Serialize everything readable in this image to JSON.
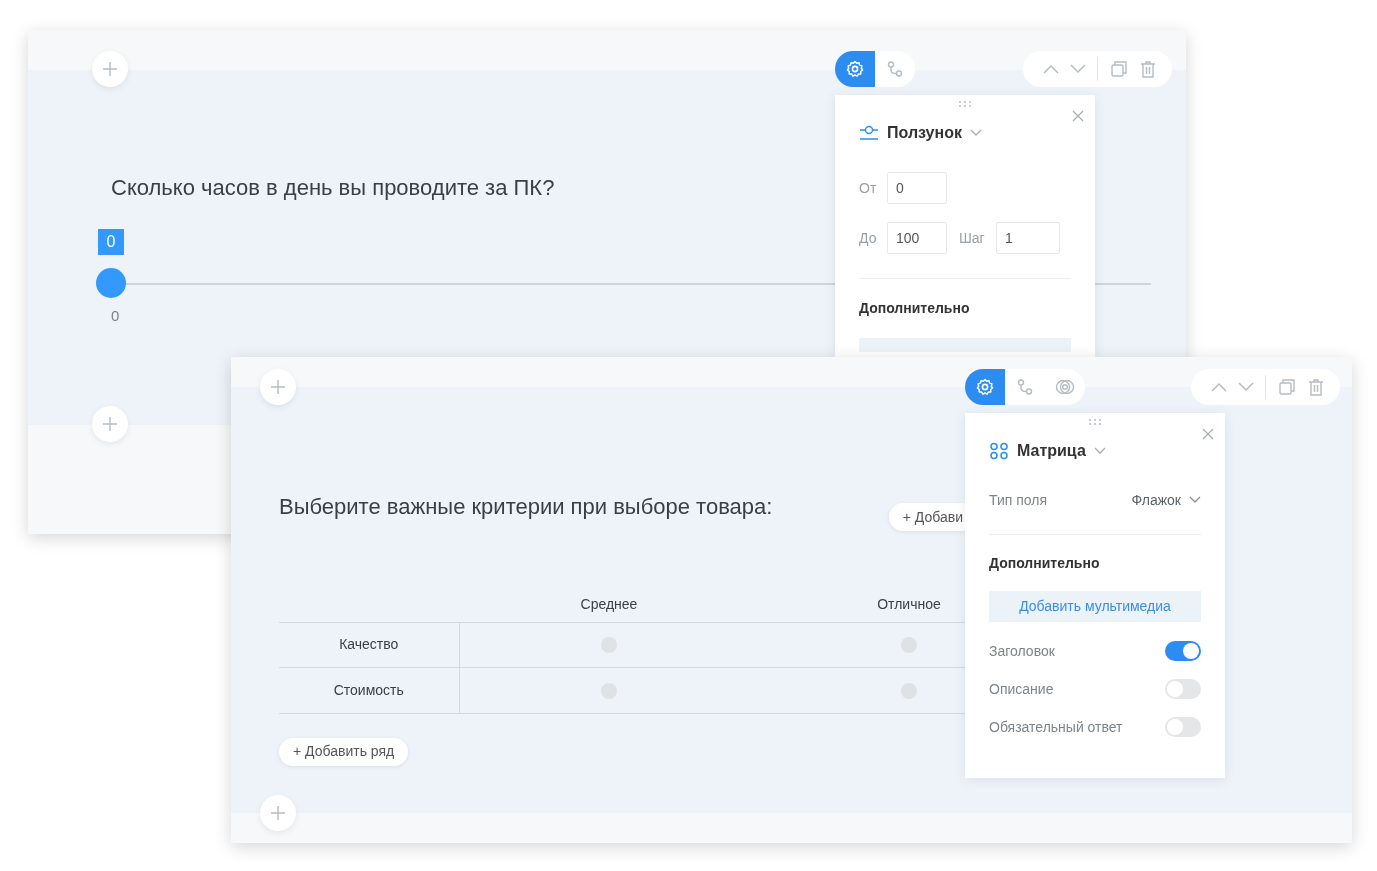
{
  "cards": [
    {
      "kind": "slider",
      "question": "Сколько часов в день вы проводите за ПК?",
      "tabs": [
        {
          "selected": true
        },
        {
          "selected": false
        }
      ],
      "slider": {
        "value": "0",
        "level": 0,
        "min_label": "0"
      },
      "panel": {
        "type": "Ползунок",
        "field_rows": [
          [
            {
              "label": "От",
              "value": "0"
            }
          ],
          [
            {
              "label": "До",
              "value": "100"
            },
            {
              "label": "Шаг",
              "value": "1"
            }
          ]
        ],
        "section": "Дополнительно"
      }
    },
    {
      "kind": "matrix",
      "question": "Выберите важные критерии при выборе товара:",
      "tabs": [
        {
          "selected": true
        },
        {
          "selected": false
        },
        {
          "selected": false
        }
      ],
      "matrix": {
        "add_column": "+ Добави",
        "columns": [
          "Среднее",
          "Отличное"
        ],
        "rows": [
          {
            "label": "Качество",
            "cells": [
              {
                "selected": false
              },
              {
                "selected": false
              }
            ]
          },
          {
            "label": "Стоимость",
            "cells": [
              {
                "selected": false
              },
              {
                "selected": false
              }
            ]
          }
        ],
        "add_row": "+ Добавить ряд"
      },
      "panel": {
        "type": "Матрица",
        "field_type": {
          "label": "Тип поля",
          "value": "Флажок"
        },
        "section": "Дополнительно",
        "media_button": "Добавить мультимедиа",
        "toggles": [
          {
            "label": "Заголовок",
            "on": true
          },
          {
            "label": "Описание",
            "on": false
          },
          {
            "label": "Обязательный ответ",
            "on": false
          }
        ]
      }
    }
  ]
}
